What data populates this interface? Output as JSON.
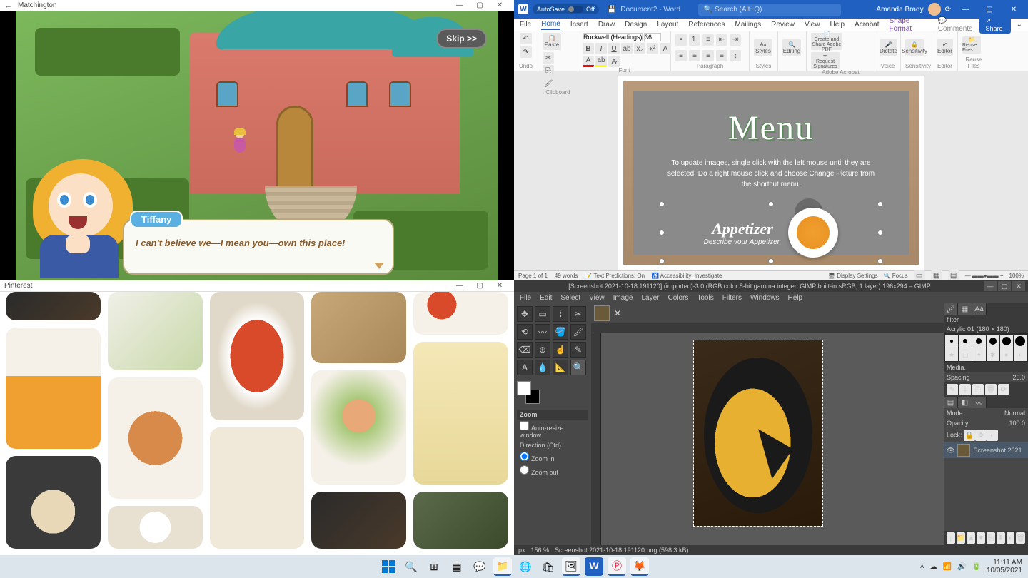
{
  "matchington": {
    "title": "Matchington",
    "skip": "Skip >>",
    "speaker": "Tiffany",
    "dialog": "I can't believe we—I mean you—own this place!"
  },
  "word": {
    "autosave_label": "AutoSave",
    "autosave_state": "Off",
    "doc_name": "Document2 - Word",
    "search_placeholder": "Search (Alt+Q)",
    "user_name": "Amanda Brady",
    "tabs": [
      "File",
      "Home",
      "Insert",
      "Draw",
      "Design",
      "Layout",
      "References",
      "Mailings",
      "Review",
      "View",
      "Help",
      "Acrobat",
      "Shape Format"
    ],
    "active_tab": "Home",
    "comments": "Comments",
    "share": "Share",
    "ribbon": {
      "undo": "Undo",
      "clipboard": "Clipboard",
      "paste": "Paste",
      "font": "Font",
      "font_name": "Rockwell (Headings)",
      "font_size": "36",
      "paragraph": "Paragraph",
      "styles": "Styles",
      "styles_btn": "Styles",
      "editing": "Editing",
      "adobe": "Adobe Acrobat",
      "adobe1": "Create and Share Adobe PDF",
      "adobe2": "Request Signatures",
      "voice": "Voice",
      "dictate": "Dictate",
      "sensitivity": "Sensitivity",
      "sensitivity_btn": "Sensitivity",
      "editor": "Editor",
      "editor_btn": "Editor",
      "reuse": "Reuse Files",
      "reuse_btn": "Reuse Files"
    },
    "menu_doc": {
      "title": "Menu",
      "instructions": "To update images, single click with the left mouse until they are selected.  Do a right mouse click and choose Change Picture from the shortcut menu.",
      "appetizer": "Appetizer",
      "appetizer_sub": "Describe your Appetizer."
    },
    "status": {
      "page": "Page 1 of 1",
      "words": "49 words",
      "predictions": "Text Predictions: On",
      "accessibility": "Accessibility: Investigate",
      "display": "Display Settings",
      "focus": "Focus",
      "zoom": "100%"
    }
  },
  "pinterest": {
    "title": "Pinterest"
  },
  "gimp": {
    "title": "[Screenshot 2021-10-18 191120] (imported)-3.0 (RGB color 8-bit gamma integer, GIMP built-in sRGB, 1 layer) 196x294 – GIMP",
    "menus": [
      "File",
      "Edit",
      "Select",
      "View",
      "Image",
      "Layer",
      "Colors",
      "Tools",
      "Filters",
      "Windows",
      "Help"
    ],
    "tool_options": {
      "header": "Zoom",
      "auto_resize": "Auto-resize window",
      "direction": "Direction  (Ctrl)",
      "zoom_in": "Zoom in",
      "zoom_out": "Zoom out"
    },
    "brushes": {
      "filter_label": "filter",
      "current": "Acrylic 01 (180 × 180)",
      "media": "Media.",
      "spacing": "Spacing",
      "spacing_val": "25.0"
    },
    "layers": {
      "mode": "Mode",
      "mode_val": "Normal",
      "opacity": "Opacity",
      "opacity_val": "100.0",
      "lock": "Lock:",
      "layer_name": "Screenshot 2021"
    },
    "status": {
      "px": "px",
      "zoom": "156 %",
      "file": "Screenshot 2021-10-18 191120.png (598.3 kB)"
    }
  },
  "taskbar": {
    "time": "11:11 AM",
    "date": "10/05/2021"
  }
}
